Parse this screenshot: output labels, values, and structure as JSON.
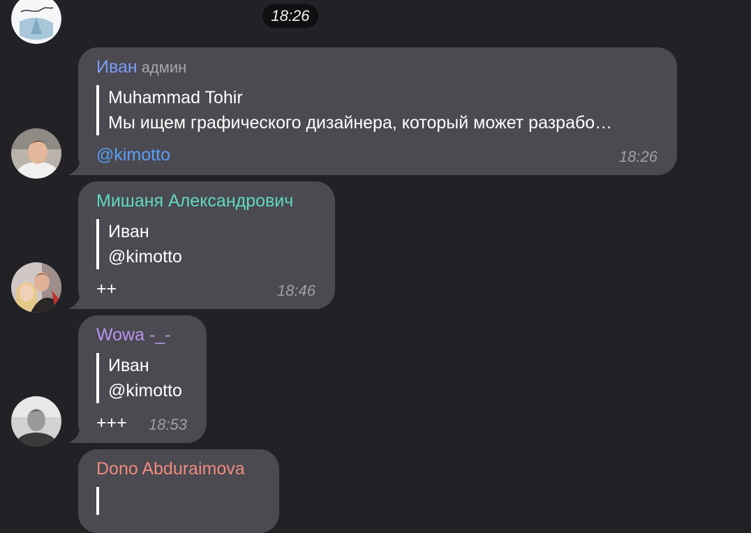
{
  "date_separator": "18:26",
  "messages": [
    {
      "sender": "Иван",
      "role": "админ",
      "sender_color": "#7c9cf7",
      "reply_author": "Muhammad Tohir",
      "reply_text": "Мы ищем графического дизайнера, который может разрабо…",
      "text": "@kimotto",
      "time": "18:26"
    },
    {
      "sender": "Мишаня Александрович",
      "sender_color": "#62d8c4",
      "reply_author": "Иван",
      "reply_text": "@kimotto",
      "text": "++",
      "time": "18:46"
    },
    {
      "sender": "Wowa -_-",
      "sender_color": "#b994f2",
      "reply_author": "Иван",
      "reply_text": "@kimotto",
      "text": "+++",
      "time": "18:53"
    },
    {
      "sender": "Dono Abduraimova",
      "sender_color": "#f08a7e"
    }
  ],
  "colors": {
    "background": "#222226",
    "bubble": "#4a4a50",
    "link": "#5a9ef8",
    "timestamp": "#9f9fa6"
  }
}
